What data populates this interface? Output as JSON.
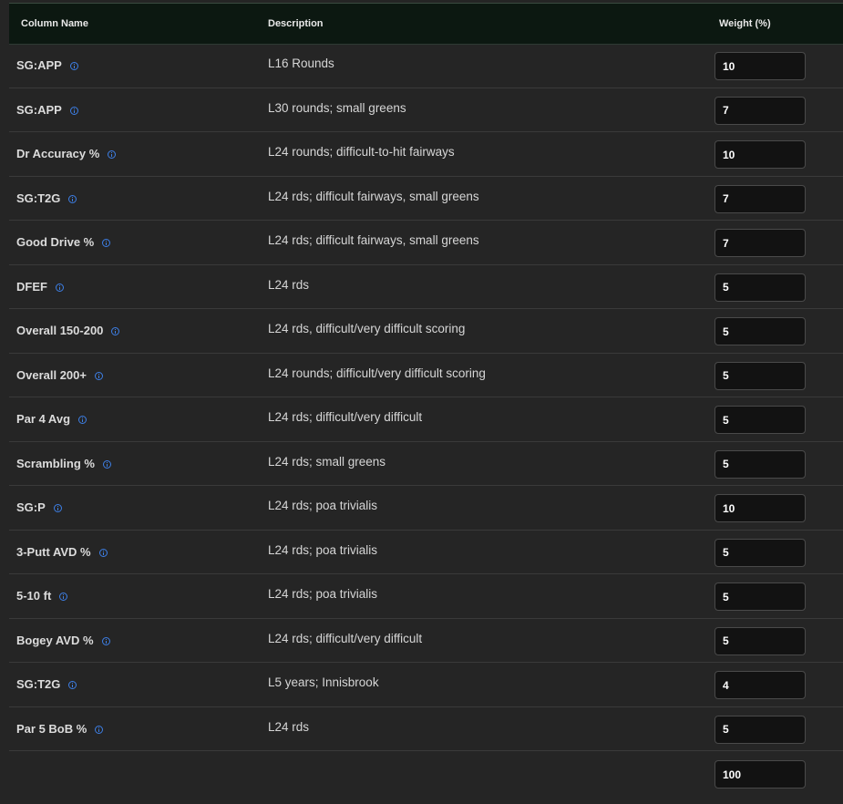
{
  "table": {
    "headers": {
      "name": "Column Name",
      "description": "Description",
      "weight": "Weight (%)"
    },
    "rows": [
      {
        "name": "SG:APP",
        "description": "L16 Rounds",
        "weight": "10"
      },
      {
        "name": "SG:APP",
        "description": "L30 rounds; small greens",
        "weight": "7"
      },
      {
        "name": "Dr Accuracy %",
        "description": "L24 rounds; difficult-to-hit fairways",
        "weight": "10"
      },
      {
        "name": "SG:T2G",
        "description": "L24 rds; difficult fairways, small greens",
        "weight": "7"
      },
      {
        "name": "Good Drive %",
        "description": "L24 rds; difficult fairways, small greens",
        "weight": "7"
      },
      {
        "name": "DFEF",
        "description": "L24 rds",
        "weight": "5"
      },
      {
        "name": "Overall 150-200",
        "description": "L24 rds, difficult/very difficult scoring",
        "weight": "5"
      },
      {
        "name": "Overall 200+",
        "description": "L24 rounds; difficult/very difficult scoring",
        "weight": "5"
      },
      {
        "name": "Par 4 Avg",
        "description": "L24 rds; difficult/very difficult",
        "weight": "5"
      },
      {
        "name": "Scrambling %",
        "description": "L24 rds; small greens",
        "weight": "5"
      },
      {
        "name": "SG:P",
        "description": "L24 rds; poa trivialis",
        "weight": "10"
      },
      {
        "name": "3-Putt AVD %",
        "description": "L24 rds; poa trivialis",
        "weight": "5"
      },
      {
        "name": "5-10 ft",
        "description": "L24 rds; poa trivialis",
        "weight": "5"
      },
      {
        "name": "Bogey AVD %",
        "description": "L24 rds; difficult/very difficult",
        "weight": "5"
      },
      {
        "name": "SG:T2G",
        "description": "L5 years; Innisbrook",
        "weight": "4"
      },
      {
        "name": "Par 5 BoB %",
        "description": "L24 rds",
        "weight": "5"
      }
    ],
    "total_weight": "100"
  },
  "colors": {
    "header_bg": "#0c1811",
    "row_bg": "#252525",
    "info_icon": "#3d7fe6",
    "input_bg": "#121212"
  },
  "icons": {
    "info": "info-circle-icon"
  }
}
